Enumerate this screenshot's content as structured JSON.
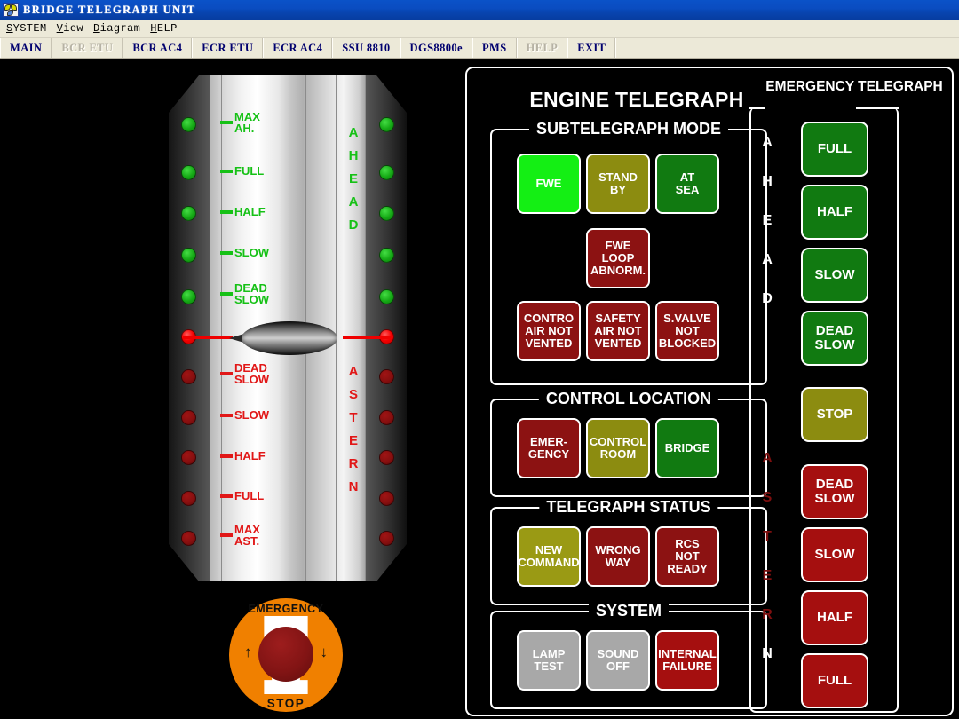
{
  "window": {
    "title": "BRIDGE TELEGRAPH UNIT",
    "icon": "propeller-icon"
  },
  "menubar": [
    {
      "label": "SYSTEM",
      "mnemonic": "S"
    },
    {
      "label": "View",
      "mnemonic": "V"
    },
    {
      "label": "Diagram",
      "mnemonic": "D"
    },
    {
      "label": "HELP",
      "mnemonic": "H"
    }
  ],
  "toolbar": [
    {
      "label": "MAIN",
      "disabled": false
    },
    {
      "label": "BCR ETU",
      "disabled": true
    },
    {
      "label": "BCR AC4",
      "disabled": false
    },
    {
      "label": "ECR ETU",
      "disabled": false
    },
    {
      "label": "ECR AC4",
      "disabled": false
    },
    {
      "label": "SSU 8810",
      "disabled": false
    },
    {
      "label": "DGS8800e",
      "disabled": false
    },
    {
      "label": "PMS",
      "disabled": false
    },
    {
      "label": "HELP",
      "disabled": true
    },
    {
      "label": "EXIT",
      "disabled": false
    }
  ],
  "telegraph": {
    "ahead_letters": [
      "A",
      "H",
      "E",
      "A",
      "D"
    ],
    "astern_letters": [
      "A",
      "S",
      "T",
      "E",
      "R",
      "N"
    ],
    "ahead_steps": [
      {
        "label": "MAX\nAH.",
        "lamp": "green-on"
      },
      {
        "label": "FULL",
        "lamp": "green-on"
      },
      {
        "label": "HALF",
        "lamp": "green-on"
      },
      {
        "label": "SLOW",
        "lamp": "green-on"
      },
      {
        "label": "DEAD\nSLOW",
        "lamp": "green-on"
      }
    ],
    "stop_step": {
      "label": "",
      "lamp": "red-on"
    },
    "astern_steps": [
      {
        "label": "DEAD\nSLOW",
        "lamp": "red-off"
      },
      {
        "label": "SLOW",
        "lamp": "red-off"
      },
      {
        "label": "HALF",
        "lamp": "red-off"
      },
      {
        "label": "FULL",
        "lamp": "red-off"
      },
      {
        "label": "MAX\nAST.",
        "lamp": "red-off"
      }
    ],
    "pointer_position": "STOP"
  },
  "emergency_stop": {
    "top_text": "EMERGENCY",
    "bottom_text": "STOP",
    "left_arrow": "↑",
    "right_arrow": "↓"
  },
  "engine_telegraph": {
    "title": "ENGINE TELEGRAPH",
    "subtelegraph_mode": {
      "legend": "SUBTELEGRAPH MODE",
      "row1": [
        {
          "label": "FWE",
          "state": "active-green"
        },
        {
          "label": "STAND\nBY",
          "state": "olive"
        },
        {
          "label": "AT\nSEA",
          "state": "green"
        }
      ],
      "row2": [
        {
          "label": "FWE\nLOOP\nABNORM.",
          "state": "darkred"
        }
      ],
      "row3": [
        {
          "label": "CONTRO\nAIR NOT\nVENTED",
          "state": "darkred"
        },
        {
          "label": "SAFETY\nAIR NOT\nVENTED",
          "state": "darkred"
        },
        {
          "label": "S.VALVE\nNOT\nBLOCKED",
          "state": "darkred"
        }
      ]
    },
    "control_location": {
      "legend": "CONTROL LOCATION",
      "buttons": [
        {
          "label": "EMER-\nGENCY",
          "state": "darkred"
        },
        {
          "label": "CONTROL\nROOM",
          "state": "olive"
        },
        {
          "label": "BRIDGE",
          "state": "green"
        }
      ]
    },
    "telegraph_status": {
      "legend": "TELEGRAPH STATUS",
      "buttons": [
        {
          "label": "NEW\nCOMMAND",
          "state": "olive2"
        },
        {
          "label": "WRONG\nWAY",
          "state": "darkred"
        },
        {
          "label": "RCS\nNOT\nREADY",
          "state": "darkred"
        }
      ]
    },
    "system": {
      "legend": "SYSTEM",
      "buttons": [
        {
          "label": "LAMP\nTEST",
          "state": "gray"
        },
        {
          "label": "SOUND\nOFF",
          "state": "gray"
        },
        {
          "label": "INTERNAL\nFAILURE",
          "state": "red"
        }
      ]
    }
  },
  "emergency_telegraph": {
    "title": "EMERGENCY\nTELEGRAPH",
    "ahead_letters": [
      "A",
      "H",
      "E",
      "A",
      "D"
    ],
    "astern_letters": [
      "A",
      "S",
      "T",
      "E",
      "R",
      "N"
    ],
    "buttons": [
      {
        "label": "FULL",
        "state": "green",
        "section": "ahead"
      },
      {
        "label": "HALF",
        "state": "green",
        "section": "ahead"
      },
      {
        "label": "SLOW",
        "state": "green",
        "section": "ahead"
      },
      {
        "label": "DEAD\nSLOW",
        "state": "green",
        "section": "ahead"
      },
      {
        "label": "STOP",
        "state": "olive",
        "section": "stop"
      },
      {
        "label": "DEAD\nSLOW",
        "state": "red",
        "section": "astern"
      },
      {
        "label": "SLOW",
        "state": "red",
        "section": "astern"
      },
      {
        "label": "HALF",
        "state": "red",
        "section": "astern"
      },
      {
        "label": "FULL",
        "state": "red",
        "section": "astern"
      }
    ]
  },
  "colors": {
    "titlebar": "#0a4cc0",
    "chrome": "#ece9d8",
    "toolbar_text": "#00006e",
    "canvas": "#000000",
    "panel_border": "#ffffff",
    "lamp_green_on": "#15a915",
    "lamp_red_on": "#f40000",
    "lamp_red_off": "#870f0f",
    "ahead_text": "#16c116",
    "astern_text": "#e11717",
    "active_green": "#14ef14",
    "olive": "#8c8c10",
    "dark_red": "#8c1212",
    "gray_btn": "#a8a8a8",
    "estop_orange": "#f08000"
  }
}
